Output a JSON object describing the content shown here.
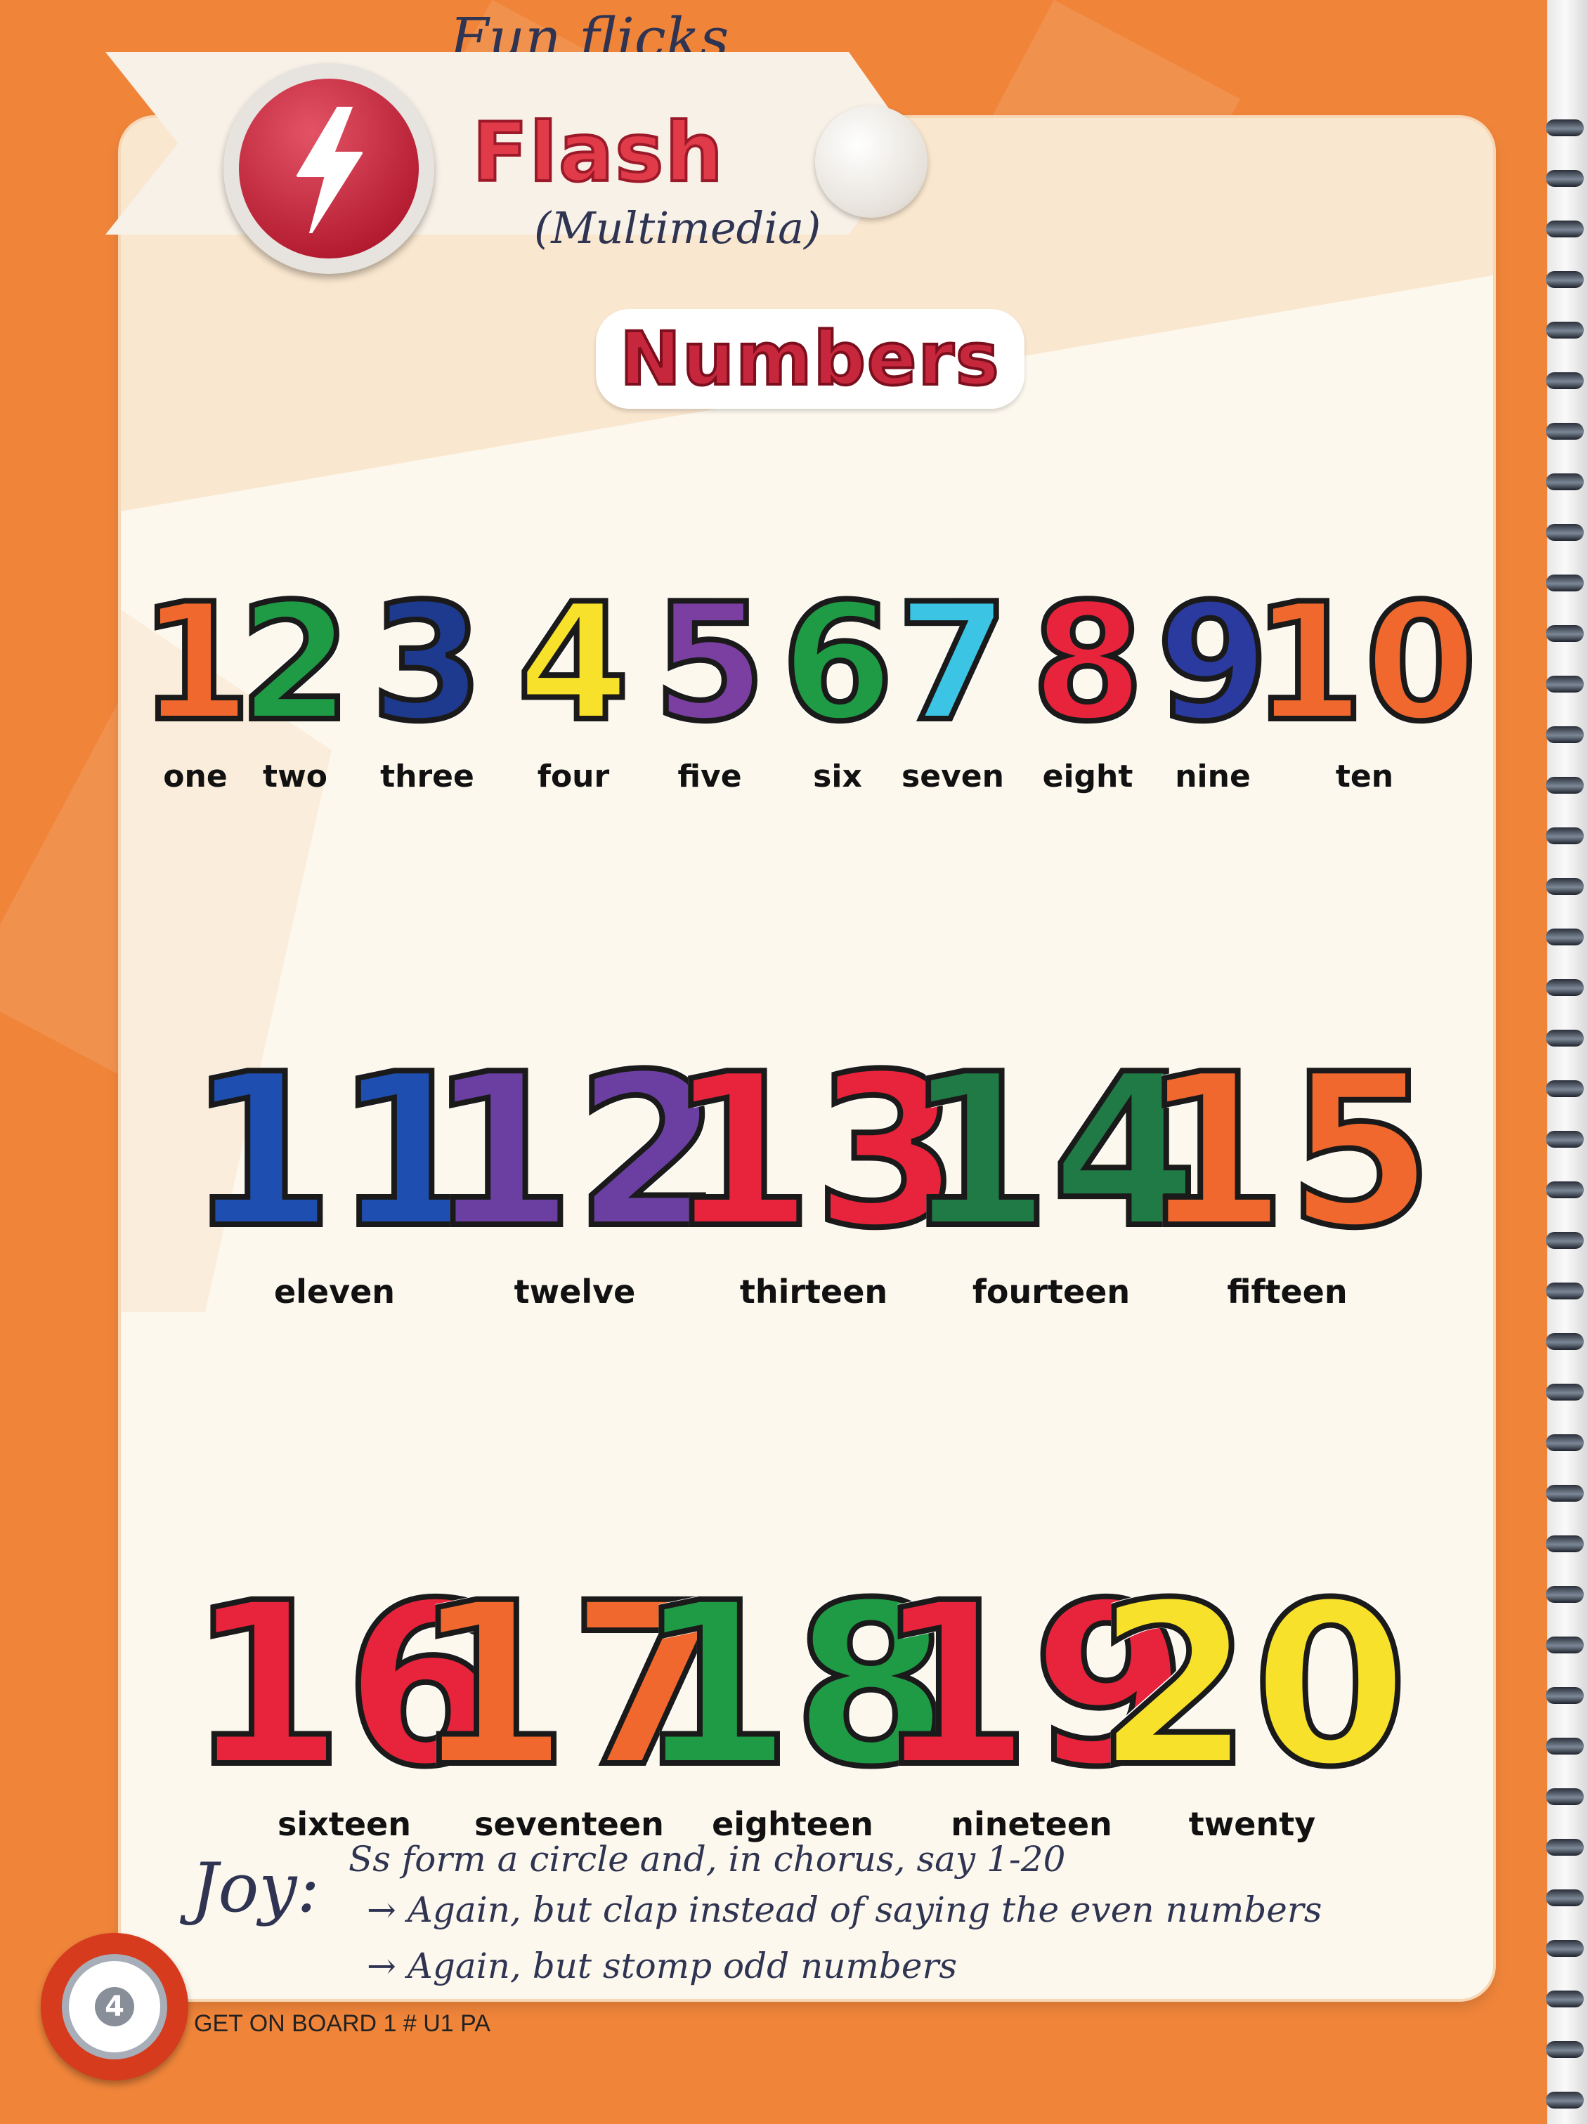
{
  "handwritten": {
    "top_note": "Fun flicks",
    "under_title": "(Multimedia)",
    "joy_label": "Joy:",
    "joy_lines": [
      "Ss form a circle and, in chorus, say 1-20",
      "→ Again, but clap instead of saying the even numbers",
      "→ Again, but stomp odd numbers"
    ]
  },
  "header": {
    "section_title": "Flash",
    "icon": "lightning-bolt-icon"
  },
  "page_title": "Numbers",
  "numbers": [
    {
      "digit": "1",
      "word": "one",
      "colors": [
        "#f0682e",
        "#f7e12a"
      ]
    },
    {
      "digit": "2",
      "word": "two",
      "colors": [
        "#1f9a45",
        "#e8233c"
      ]
    },
    {
      "digit": "3",
      "word": "three",
      "colors": [
        "#1e3a8f",
        "#f7e12a"
      ]
    },
    {
      "digit": "4",
      "word": "four",
      "colors": [
        "#f7e12a",
        "#f0682e"
      ]
    },
    {
      "digit": "5",
      "word": "five",
      "colors": [
        "#7a3fa1",
        "#f7e12a"
      ]
    },
    {
      "digit": "6",
      "word": "six",
      "colors": [
        "#1f9a45",
        "#f7e12a"
      ]
    },
    {
      "digit": "7",
      "word": "seven",
      "colors": [
        "#3bc4e4",
        "#e8233c"
      ]
    },
    {
      "digit": "8",
      "word": "eight",
      "colors": [
        "#e8233c",
        "#f7e12a"
      ]
    },
    {
      "digit": "9",
      "word": "nine",
      "colors": [
        "#2a3a9e",
        "#f0682e"
      ]
    },
    {
      "digit": "10",
      "word": "ten",
      "colors": [
        "#f0682e",
        "#f7f321"
      ]
    },
    {
      "digit": "11",
      "word": "eleven",
      "colors": [
        "#1e4fb0",
        "#f7e12a"
      ]
    },
    {
      "digit": "12",
      "word": "twelve",
      "colors": [
        "#6a3fa1",
        "#ffffff"
      ]
    },
    {
      "digit": "13",
      "word": "thirteen",
      "colors": [
        "#e8233c",
        "#f0682e"
      ]
    },
    {
      "digit": "14",
      "word": "fourteen",
      "colors": [
        "#1f7a45",
        "#f7f321"
      ]
    },
    {
      "digit": "15",
      "word": "fifteen",
      "colors": [
        "#f0682e",
        "#1d1f3a"
      ]
    },
    {
      "digit": "16",
      "word": "sixteen",
      "colors": [
        "#e8233c",
        "#1f9a45"
      ]
    },
    {
      "digit": "17",
      "word": "seventeen",
      "colors": [
        "#f0682e",
        "#f7a21a"
      ]
    },
    {
      "digit": "18",
      "word": "eighteen",
      "colors": [
        "#1f9a45",
        "#f0682e"
      ]
    },
    {
      "digit": "19",
      "word": "nineteen",
      "colors": [
        "#e8233c",
        "#7a3fa1"
      ]
    },
    {
      "digit": "20",
      "word": "twenty",
      "colors": [
        "#f7e12a",
        "#f7e12a"
      ]
    }
  ],
  "footer": {
    "page_number": "4",
    "text": "GET ON BOARD 1 # U1 PA"
  },
  "colors": {
    "page_background": "#f0853a",
    "sheet": "#fdf8ee",
    "accent_red": "#c7273c"
  }
}
